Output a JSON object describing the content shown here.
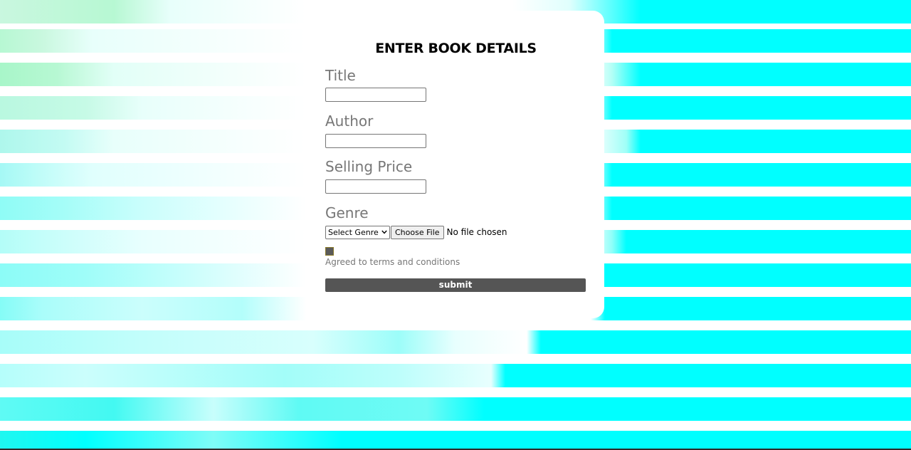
{
  "form": {
    "title": "ENTER BOOK DETAILS",
    "fields": {
      "title_label": "Title",
      "title_value": "",
      "author_label": "Author",
      "author_value": "",
      "price_label": "Selling Price",
      "price_value": "",
      "genre_label": "Genre",
      "genre_selected": "Select Genre",
      "file_button": "Choose File",
      "file_status": "No file chosen"
    },
    "terms": {
      "checked": false,
      "label": "Agreed to terms and conditions"
    },
    "submit_label": "submit"
  },
  "colors": {
    "background_stripe_primary": "#00ffff",
    "background_stripe_light": "#b3fff0",
    "card": "#ffffff",
    "label_text": "#777777",
    "submit_button": "#555555",
    "checkbox_fill": "#5a5a5a"
  },
  "icons": {
    "select_arrow": "chevron-down-icon"
  }
}
